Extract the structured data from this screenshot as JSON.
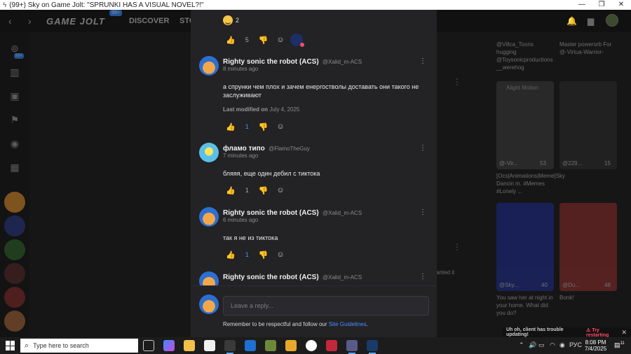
{
  "browser": {
    "title": "(99+) Sky on Game Jolt: \"SPRUNKI HAS A VISUAL NOVEL?!\"",
    "controls": [
      "—",
      "❐",
      "✕"
    ]
  },
  "header": {
    "logo": "GAME JOLT",
    "logo_badge": "99+",
    "discover": "DISCOVER",
    "store": "STO"
  },
  "sidebar": {
    "badge": "99+"
  },
  "background": {
    "cards": [
      {
        "caption": "@Villca_Toons hugging @Toysonicproductions __werehog"
      },
      {
        "caption": "Master powerorb For @-Virtua-Warrior-"
      },
      {
        "title": "Alight Motion",
        "user": "@-Vir...",
        "likes": "53",
        "caption": "[Ocs|Animations|Meme]Sky Dancin m. #Memes #Lonely ..."
      },
      {
        "user": "@229...",
        "likes": "15",
        "caption": "."
      },
      {
        "user": "@Sky...",
        "likes": "40",
        "caption": "You saw her at night in your home. What did you do?"
      },
      {
        "user": "@Du...",
        "likes": "48",
        "caption": "Bonk!"
      }
    ],
    "side_snippet": "anted it"
  },
  "thread": {
    "top_reaction": {
      "count": "2"
    },
    "top_actions": {
      "likes": "5"
    },
    "comments": [
      {
        "name": "Righty sonic the robot (ACS)",
        "handle": "@Xalid_m-ACS",
        "time": "8 minutes ago",
        "body": "а спрунки чем плох и зачем енергостволы доставать они такого не заслуживают",
        "modified_label": "Last modified on",
        "modified_date": "July 4, 2025",
        "likes": "1"
      },
      {
        "name": "фламо типо",
        "handle": "@FlamoTheGuy",
        "time": "7 minutes ago",
        "body": "бляяя, еще один дебил с тиктока",
        "likes": "1"
      },
      {
        "name": "Righty sonic the robot (ACS)",
        "handle": "@Xalid_m-ACS",
        "time": "6 minutes ago",
        "body": "так я не из тиктока",
        "likes": "1"
      },
      {
        "name": "Righty sonic the robot (ACS)",
        "handle": "@Xalid_m-ACS"
      }
    ]
  },
  "reply": {
    "placeholder": "Leave a reply...",
    "note": "Remember to be respectful and follow our",
    "link": "Site Guidelines",
    "period": "."
  },
  "toast": {
    "message": "Uh oh, client has trouble updating!",
    "action": "⚠ Try restarting",
    "close": "✕"
  },
  "taskbar": {
    "search_placeholder": "Type here to search",
    "language": "РУС",
    "time": "8:08 PM",
    "date": "7/4/2025",
    "notifications": "11"
  },
  "colors": {
    "accent": "#4a8fff",
    "modal_bg": "#232225",
    "warning": "#ff4a6a"
  }
}
